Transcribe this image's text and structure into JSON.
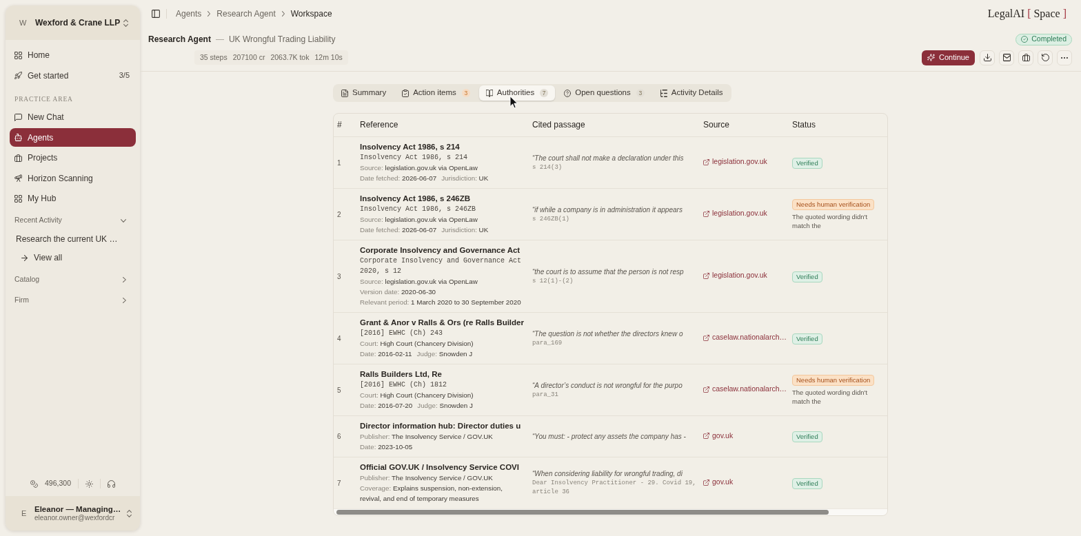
{
  "sidebar": {
    "org": {
      "initial": "W",
      "name": "Wexford & Crane LLP"
    },
    "nav": [
      {
        "label": "Home",
        "selected": false
      },
      {
        "label": "Get started",
        "selected": false,
        "count": "3/5"
      }
    ],
    "section_label": "PRACTICE AREA",
    "practice": [
      {
        "label": "New Chat",
        "selected": false
      },
      {
        "label": "Agents",
        "selected": true
      },
      {
        "label": "Projects",
        "selected": false
      },
      {
        "label": "Horizon Scanning",
        "selected": false
      },
      {
        "label": "My Hub",
        "selected": false
      }
    ],
    "groups": [
      {
        "label": "Recent Activity",
        "expanded": true,
        "items": [
          {
            "kind": "recent",
            "label": "Research the current UK …"
          },
          {
            "kind": "view_all",
            "label": "View all"
          }
        ]
      },
      {
        "label": "Catalog",
        "expanded": false
      },
      {
        "label": "Firm",
        "expanded": false
      }
    ],
    "credits": "496,300",
    "user": {
      "initial": "E",
      "name": "Eleanor — Managing…",
      "email": "eleanor.owner@wexfordcr"
    }
  },
  "header": {
    "breadcrumbs": [
      {
        "label": "Agents",
        "current": false
      },
      {
        "label": "Research Agent",
        "current": false
      },
      {
        "label": "Workspace",
        "current": true
      }
    ],
    "logo": {
      "name": "LegalAI",
      "open": "[",
      "product": "Space",
      "close": "]"
    }
  },
  "run": {
    "agent": "Research Agent",
    "separator": "—",
    "title": "UK Wrongful Trading Liability",
    "stats": [
      "35 steps",
      "207100 cr",
      "2063.7K tok",
      "12m 10s"
    ],
    "status": "Completed",
    "continue_label": "Continue"
  },
  "tabs": [
    {
      "label": "Summary",
      "selected": false
    },
    {
      "label": "Action items",
      "selected": false,
      "badge": {
        "text": "3",
        "color": "#f6dcc4"
      }
    },
    {
      "label": "Authorities",
      "selected": true,
      "badge": {
        "text": "7",
        "color": "#e3dfd6"
      }
    },
    {
      "label": "Open questions",
      "selected": false,
      "badge": {
        "text": "3",
        "color": "#e3dfd6"
      }
    },
    {
      "label": "Activity Details",
      "selected": false
    }
  ],
  "table": {
    "columns": [
      "#",
      "Reference",
      "Cited passage",
      "Source",
      "Status"
    ],
    "rows": [
      {
        "number": "1",
        "title": "Insolvency Act 1986, s 214",
        "citation": "Insolvency Act 1986, s 214",
        "details": [
          [
            {
              "label": "Source:",
              "value": "legislation.gov.uk via OpenLaw"
            }
          ],
          [
            {
              "label": "Date fetched:",
              "value": "2026-06-07"
            },
            {
              "label": "Jurisdiction:",
              "value": "UK"
            }
          ]
        ],
        "passage": "“The court shall not make a declaration under this",
        "pinpoint": "s 214(3)",
        "source": "legislation.gov.uk",
        "status": {
          "kind": "verified",
          "label": "Verified"
        }
      },
      {
        "number": "2",
        "title": "Insolvency Act 1986, s 246ZB",
        "citation": "Insolvency Act 1986, s 246ZB",
        "details": [
          [
            {
              "label": "Source:",
              "value": "legislation.gov.uk via OpenLaw"
            }
          ],
          [
            {
              "label": "Date fetched:",
              "value": "2026-06-07"
            },
            {
              "label": "Jurisdiction:",
              "value": "UK"
            }
          ]
        ],
        "passage": "“if while a company is in administration it appears",
        "pinpoint": "s 246ZB(1)",
        "source": "legislation.gov.uk",
        "status": {
          "kind": "needs_review",
          "label": "Needs human verification",
          "note": "The quoted wording didn't match the"
        }
      },
      {
        "number": "3",
        "title": "Corporate Insolvency and Governance Act",
        "citation": "Corporate Insolvency and Governance Act 2020, s 12",
        "details": [
          [
            {
              "label": "Source:",
              "value": "legislation.gov.uk via OpenLaw"
            }
          ],
          [
            {
              "label": "Version date:",
              "value": "2020-06-30"
            }
          ],
          [
            {
              "label": "Relevant period:",
              "value": "1 March 2020 to 30 September 2020"
            }
          ]
        ],
        "passage": "“the court is to assume that the person is not resp",
        "pinpoint": "s 12(1)-(2)",
        "source": "legislation.gov.uk",
        "status": {
          "kind": "verified",
          "label": "Verified"
        }
      },
      {
        "number": "4",
        "title": "Grant & Anor v Ralls & Ors (re Ralls Builder",
        "citation": "[2016] EWHC (Ch) 243",
        "details": [
          [
            {
              "label": "Court:",
              "value": "High Court (Chancery Division)"
            }
          ],
          [
            {
              "label": "Date:",
              "value": "2016-02-11"
            },
            {
              "label": "Judge:",
              "value": "Snowden J"
            }
          ]
        ],
        "passage": "“The question is not whether the directors knew o",
        "pinpoint": "para_169",
        "source": "caselaw.nationalarch…",
        "status": {
          "kind": "verified",
          "label": "Verified"
        }
      },
      {
        "number": "5",
        "title": "Ralls Builders Ltd, Re",
        "citation": "[2016] EWHC (Ch) 1812",
        "details": [
          [
            {
              "label": "Court:",
              "value": "High Court (Chancery Division)"
            }
          ],
          [
            {
              "label": "Date:",
              "value": "2016-07-20"
            },
            {
              "label": "Judge:",
              "value": "Snowden J"
            }
          ]
        ],
        "passage": "“A director’s conduct is not wrongful for the purpo",
        "pinpoint": "para_31",
        "source": "caselaw.nationalarch…",
        "status": {
          "kind": "needs_review",
          "label": "Needs human verification",
          "note": "The quoted wording didn't match the"
        }
      },
      {
        "number": "6",
        "title": "Director information hub: Director duties u",
        "details": [
          [
            {
              "label": "Publisher:",
              "value": "The Insolvency Service / GOV.UK"
            }
          ],
          [
            {
              "label": "Date:",
              "value": "2023-10-05"
            }
          ]
        ],
        "passage": "“You must: - protect any assets the company has -",
        "source": "gov.uk",
        "status": {
          "kind": "verified",
          "label": "Verified"
        }
      },
      {
        "number": "7",
        "title": "Official GOV.UK / Insolvency Service COVI",
        "details": [
          [
            {
              "label": "Publisher:",
              "value": "The Insolvency Service / GOV.UK"
            }
          ],
          [
            {
              "label": "Coverage:",
              "value": "Explains suspension, non-extension, revival, and end of temporary measures"
            }
          ]
        ],
        "passage": "“When considering liability for wrongful trading, di",
        "pinpoint": "Dear Insolvency Practitioner - 29. Covid 19, article 36",
        "source": "gov.uk",
        "status": {
          "kind": "verified",
          "label": "Verified"
        }
      }
    ]
  }
}
